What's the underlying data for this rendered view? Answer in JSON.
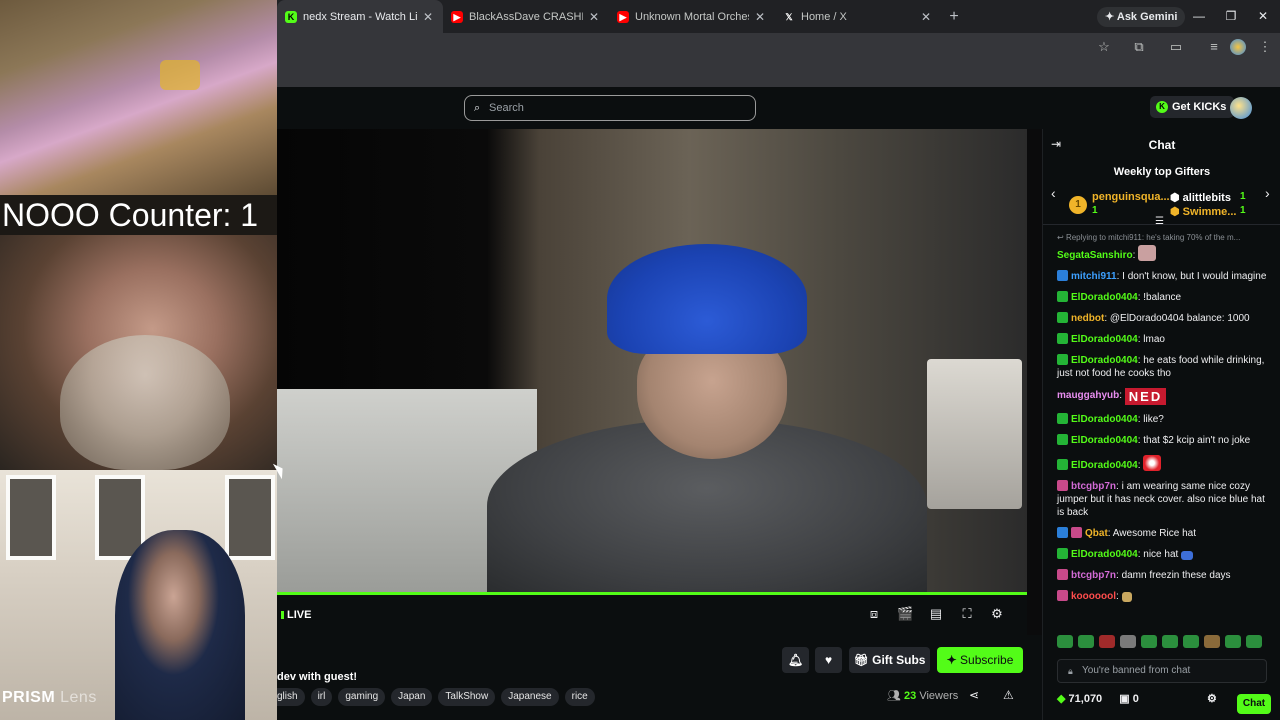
{
  "overlay": {
    "counter_text": "NOOO Counter: 1",
    "prism_brand": "PRISM",
    "prism_sub": "Lens"
  },
  "browser": {
    "tabs": [
      {
        "title": "nedx Stream - Watch Live on Ki",
        "icon": "kick-favicon",
        "color": "#53fc18",
        "active": true
      },
      {
        "title": "BlackAssDave CRASHES OUT At",
        "icon": "youtube-favicon",
        "color": "#ff0000",
        "active": false
      },
      {
        "title": "Unknown Mortal Orchestra - H",
        "icon": "youtube-favicon",
        "color": "#ff0000",
        "active": false
      },
      {
        "title": "Home / X",
        "icon": "x-favicon",
        "color": "#ffffff",
        "active": false
      }
    ],
    "new_tab": "+",
    "gemini": "Ask Gemini"
  },
  "kick": {
    "search_placeholder": "Search",
    "get_kicks": "Get KICKs",
    "live_label": "LIVE",
    "stream_title": "dev with guest!",
    "tags": [
      "glish",
      "irl",
      "gaming",
      "Japan",
      "TalkShow",
      "Japanese",
      "rice"
    ],
    "gift_subs": "Gift Subs",
    "subscribe": "Subscribe",
    "viewer_count": "23",
    "viewers_label": "Viewers",
    "accent": "#53fc18"
  },
  "chat": {
    "title": "Chat",
    "gifters_title": "Weekly top Gifters",
    "gifters": [
      {
        "rank": "1",
        "name": "penguinsqua...",
        "count": "1",
        "color": "#f0b429"
      },
      {
        "name": "alittlebits",
        "count": "1",
        "color": "#ffffff"
      },
      {
        "name": "Swimme...",
        "count": "1",
        "color": "#f0b429"
      }
    ],
    "reply_line": "Replying to mitchi911: he's taking 70% of the m...",
    "messages": [
      {
        "user": "SegataSanshiro",
        "text": "",
        "color": "#53fc18",
        "badge": "none"
      },
      {
        "user": "mitchi911",
        "text": "I don't know, but I would imagine",
        "color": "#3da0ff",
        "badge": "blue"
      },
      {
        "user": "ElDorado0404",
        "text": "!balance",
        "color": "#53fc18",
        "badge": "green"
      },
      {
        "user": "nedbot",
        "text": "@ElDorado0404 balance: 1000",
        "color": "#f0b429",
        "badge": "green"
      },
      {
        "user": "ElDorado0404",
        "text": "lmao",
        "color": "#53fc18",
        "badge": "green"
      },
      {
        "user": "ElDorado0404",
        "text": "he eats food while drinking, just not food he cooks tho",
        "color": "#53fc18",
        "badge": "green"
      },
      {
        "user": "mauggahyub",
        "text": "NED",
        "color": "#e88ef0",
        "badge": "none"
      },
      {
        "user": "ElDorado0404",
        "text": "like?",
        "color": "#53fc18",
        "badge": "green"
      },
      {
        "user": "ElDorado0404",
        "text": "that $2 kcip ain't no joke",
        "color": "#53fc18",
        "badge": "green"
      },
      {
        "user": "ElDorado0404",
        "text": "",
        "color": "#53fc18",
        "badge": "green"
      },
      {
        "user": "btcgbp7n",
        "text": "i am wearing same nice cozy jumper but it has neck cover. also nice blue hat is back",
        "color": "#d36bd6",
        "badge": "pink"
      },
      {
        "user": "Qbat",
        "text": "Awesome Rice hat",
        "color": "#f0b429",
        "badge": "blue"
      },
      {
        "user": "ElDorado0404",
        "text": "nice hat",
        "color": "#53fc18",
        "badge": "green"
      },
      {
        "user": "btcgbp7n",
        "text": "damn freezin these days",
        "color": "#d36bd6",
        "badge": "pink"
      },
      {
        "user": "kooooool",
        "text": "",
        "color": "#ff4d4d",
        "badge": "pink"
      }
    ],
    "banned_text": "You're banned from chat",
    "kicks_balance": "71,070",
    "gift_count": "0",
    "chat_button": "Chat"
  }
}
